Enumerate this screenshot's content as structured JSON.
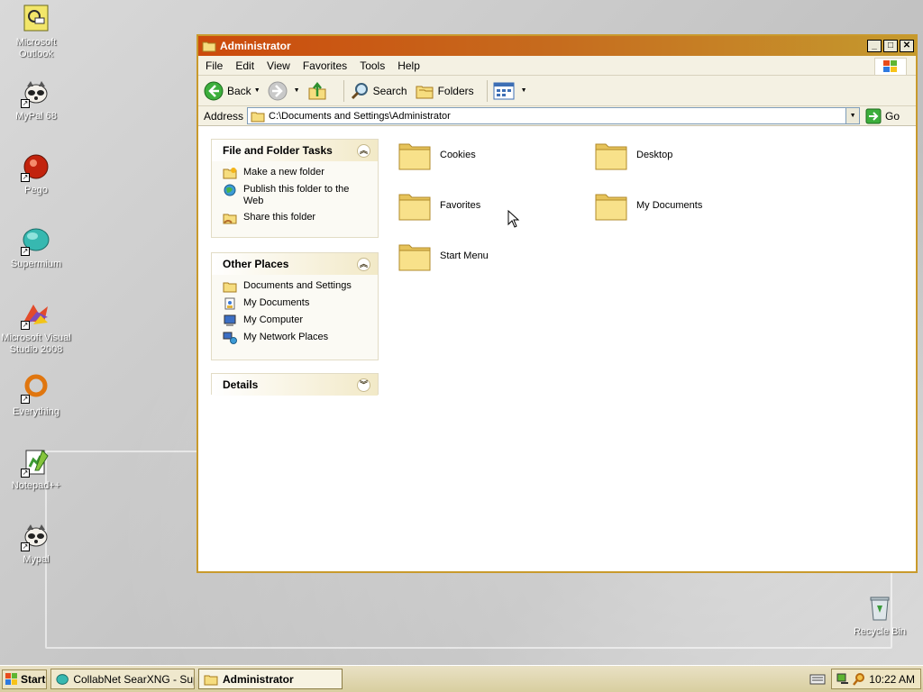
{
  "desktop": {
    "icons": [
      {
        "label": "Microsoft Outlook"
      },
      {
        "label": "MyPal 68"
      },
      {
        "label": "Pego"
      },
      {
        "label": "Supermium"
      },
      {
        "label": "Microsoft Visual Studio 2008"
      },
      {
        "label": "Everything"
      },
      {
        "label": "Notepad++"
      },
      {
        "label": "Mypal"
      },
      {
        "label": "Recycle Bin"
      }
    ]
  },
  "window": {
    "title": "Administrator",
    "menu": [
      "File",
      "Edit",
      "View",
      "Favorites",
      "Tools",
      "Help"
    ],
    "toolbar": {
      "back": "Back",
      "search": "Search",
      "folders": "Folders"
    },
    "address": {
      "label": "Address",
      "value": "C:\\Documents and Settings\\Administrator",
      "go": "Go"
    },
    "tasks_panel": {
      "title": "File and Folder Tasks",
      "items": [
        "Make a new folder",
        "Publish this folder to the Web",
        "Share this folder"
      ]
    },
    "other_places_panel": {
      "title": "Other Places",
      "items": [
        "Documents and Settings",
        "My Documents",
        "My Computer",
        "My Network Places"
      ]
    },
    "details_panel": {
      "title": "Details"
    },
    "files": [
      "Cookies",
      "Desktop",
      "Favorites",
      "My Documents",
      "Start Menu"
    ]
  },
  "taskbar": {
    "start": "Start",
    "tasks": [
      "CollabNet SearXNG - Sup...",
      "Administrator"
    ],
    "clock": "10:22 AM"
  },
  "colors": {
    "title_start": "#cc4a0c",
    "title_end": "#c59a2e",
    "folder": "#f6dd7f"
  }
}
